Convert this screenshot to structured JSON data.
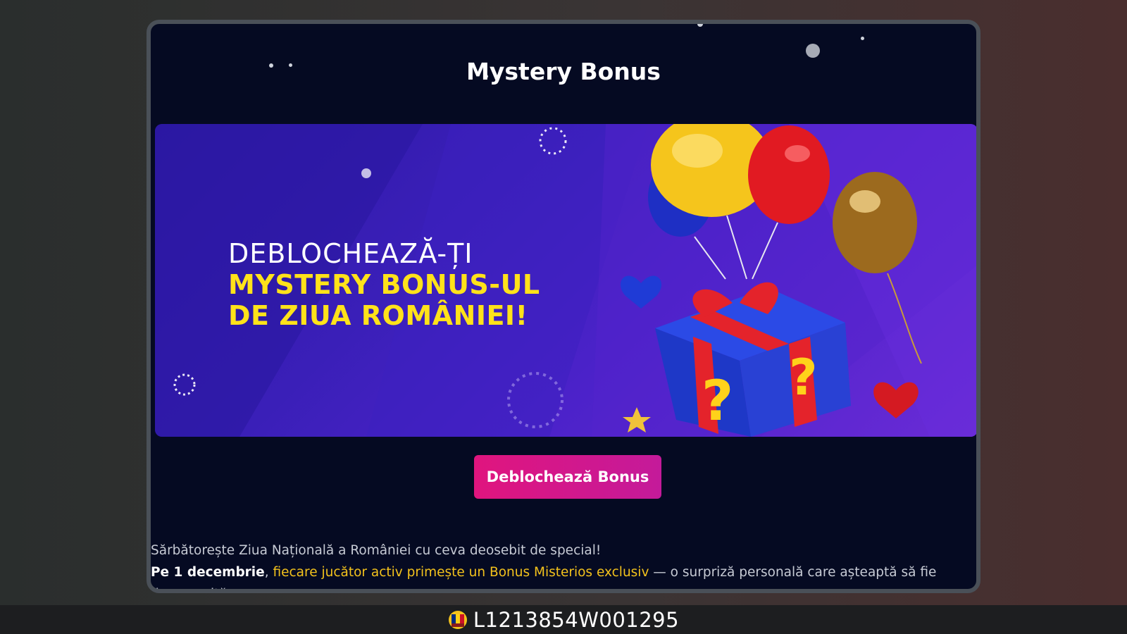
{
  "modal": {
    "title": "Mystery Bonus",
    "banner": {
      "line1": "DEBLOCHEAZĂ-ȚI",
      "line2": "MYSTERY BONUS-UL",
      "line3": "DE ZIUA ROMÂNIEI!"
    },
    "cta_label": "Deblochează Bonus",
    "description": {
      "line1": "Sărbătorește Ziua Națională a României cu ceva deosebit de special!",
      "line2_bold": "Pe 1 decembrie",
      "line2_sep": ", ",
      "line2_highlight": "fiecare jucător activ primește un Bonus Misterios exclusiv",
      "line2_rest": " — o surpriză personală care așteaptă să fie descoperită."
    }
  },
  "footer": {
    "license_id": "L1213854W001295",
    "badge_icon": "romania-onjn-badge-icon"
  },
  "colors": {
    "modal_bg": "#050a22",
    "cta": "#e0157e",
    "highlight": "#f3c21c",
    "headline_yellow": "#ffe21a"
  }
}
